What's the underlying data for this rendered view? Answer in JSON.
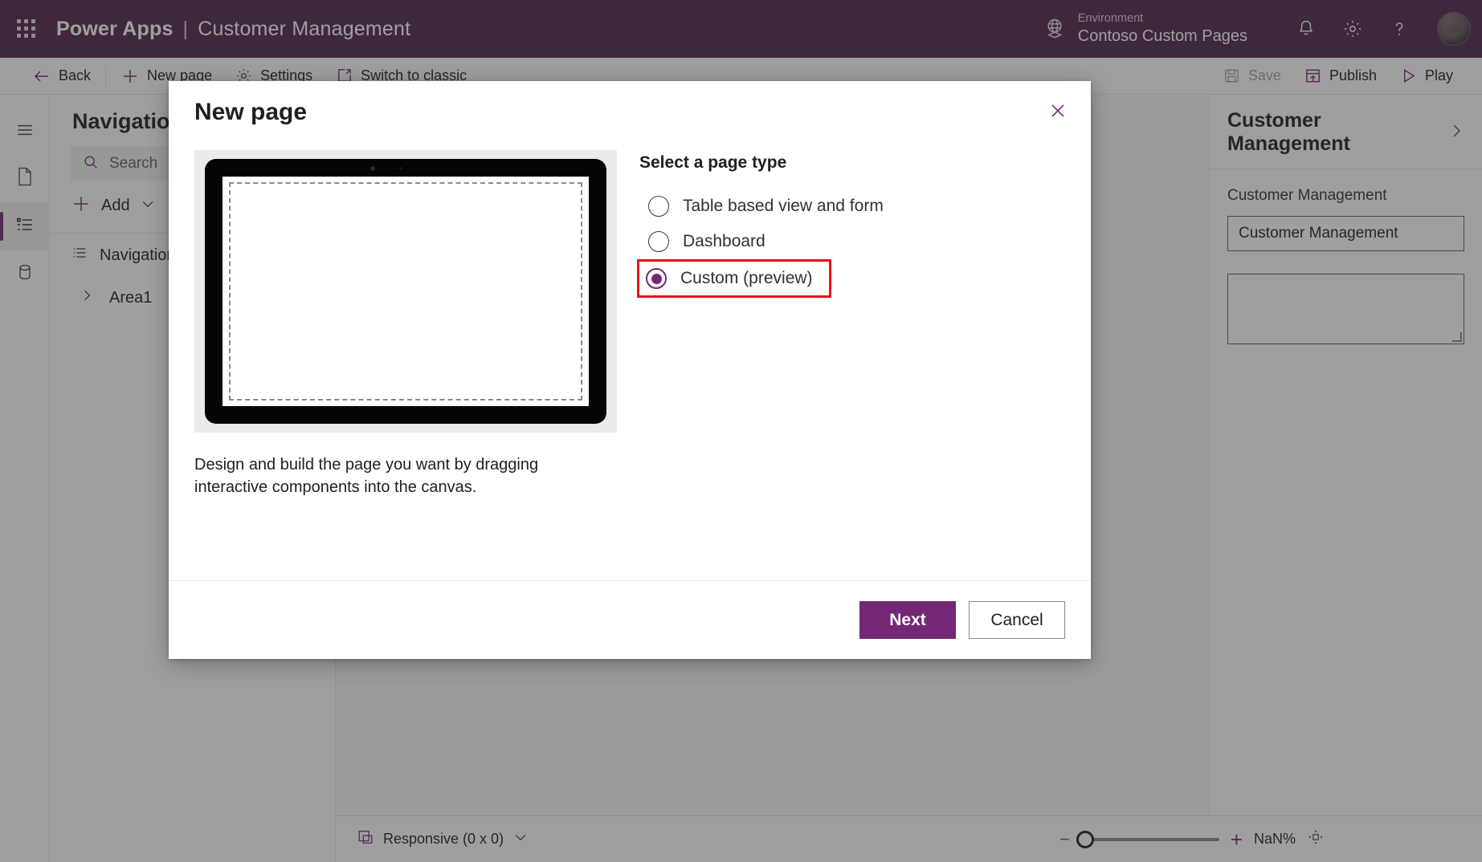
{
  "brandbar": {
    "waffle_icon": "app-launcher-icon",
    "product": "Power Apps",
    "separator": "|",
    "app_name": "Customer Management",
    "globe_icon": "globe-icon",
    "environment_label": "Environment",
    "environment_name": "Contoso Custom Pages",
    "notifications_icon": "bell-icon",
    "settings_icon": "gear-icon",
    "help_icon": "question-mark-icon",
    "avatar": "user-avatar"
  },
  "commandbar": {
    "back": "Back",
    "new_page": "New page",
    "settings": "Settings",
    "switch_to_classic": "Switch to classic",
    "save": "Save",
    "publish": "Publish",
    "play": "Play"
  },
  "rail": {
    "items": [
      {
        "icon": "hamburger-menu-icon",
        "name": "menu",
        "selected": false
      },
      {
        "icon": "page-icon",
        "name": "pages",
        "selected": false
      },
      {
        "icon": "navigation-list-icon",
        "name": "navigation",
        "selected": true
      },
      {
        "icon": "data-cylinder-icon",
        "name": "data",
        "selected": false
      }
    ]
  },
  "navpanel": {
    "title": "Navigation",
    "search_placeholder": "Search",
    "search_icon": "search-icon",
    "add_label": "Add",
    "add_icon": "plus-icon",
    "add_chevron": "chevron-down-icon",
    "tree": [
      {
        "label": "Navigation",
        "icon": "list-icon",
        "level": 0
      },
      {
        "label": "Area1",
        "icon": "chevron-right-icon",
        "level": 1
      }
    ]
  },
  "proppanel": {
    "title": "Customer Management",
    "expand_icon": "chevron-right-icon",
    "field_label": "Customer Management",
    "field_value": "Customer Management"
  },
  "statusbar": {
    "screen_icon": "responsive-screen-icon",
    "size_label": "Responsive (0 x 0)",
    "size_chevron": "chevron-down-icon",
    "zoom_out": "−",
    "zoom_in": "+",
    "zoom_value": "NaN%",
    "fit_icon": "fit-to-screen-icon"
  },
  "modal": {
    "title": "New page",
    "close_icon": "close-icon",
    "preview": {
      "image_alt": "tablet-device-mockup",
      "description": "Design and build the page you want by dragging interactive components into the canvas."
    },
    "page_type": {
      "heading": "Select a page type",
      "options": [
        {
          "label": "Table based view and form",
          "selected": false,
          "highlighted": false
        },
        {
          "label": "Dashboard",
          "selected": false,
          "highlighted": false
        },
        {
          "label": "Custom (preview)",
          "selected": true,
          "highlighted": true
        }
      ]
    },
    "footer": {
      "next": "Next",
      "cancel": "Cancel"
    }
  },
  "colors": {
    "brand_purple": "#4f2349",
    "accent_purple": "#742774",
    "highlight_red": "#e81123"
  }
}
